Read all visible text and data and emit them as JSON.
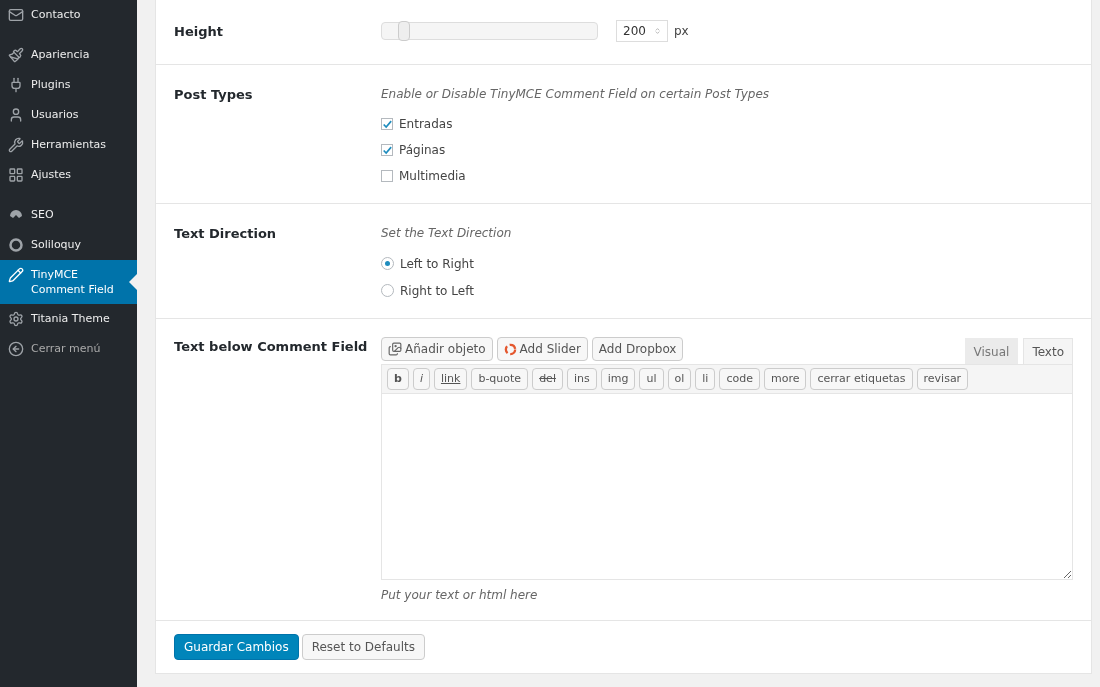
{
  "sidebar": {
    "items": [
      {
        "label": "Contacto",
        "selected": false
      },
      {
        "label": "Apariencia",
        "selected": false
      },
      {
        "label": "Plugins",
        "selected": false
      },
      {
        "label": "Usuarios",
        "selected": false
      },
      {
        "label": "Herramientas",
        "selected": false
      },
      {
        "label": "Ajustes",
        "selected": false
      },
      {
        "label": "SEO",
        "selected": false
      },
      {
        "label": "Soliloquy",
        "selected": false
      },
      {
        "label": "TinyMCE Comment Field",
        "selected": true
      },
      {
        "label": "Titania Theme",
        "selected": false
      },
      {
        "label": "Cerrar menú",
        "selected": false
      }
    ]
  },
  "settings": {
    "height": {
      "label": "Height",
      "level": 0.1,
      "value": "200",
      "unit": "px"
    },
    "post_types": {
      "label": "Post Types",
      "description": "Enable or Disable TinyMCE Comment Field on certain Post Types",
      "options": [
        {
          "label": "Entradas",
          "checked": true
        },
        {
          "label": "Páginas",
          "checked": true
        },
        {
          "label": "Multimedia",
          "checked": false
        }
      ]
    },
    "text_direction": {
      "label": "Text Direction",
      "description": "Set the Text Direction",
      "options": [
        {
          "label": "Left to Right",
          "selected": true
        },
        {
          "label": "Right to Left",
          "selected": false
        }
      ]
    },
    "text_below": {
      "label": "Text below Comment Field",
      "media_buttons": [
        "Añadir objeto",
        "Add Slider",
        "Add Dropbox"
      ],
      "tabs": [
        {
          "label": "Visual",
          "selected": false
        },
        {
          "label": "Texto",
          "selected": true
        }
      ],
      "quicktags": [
        "b",
        "i",
        "link",
        "b-quote",
        "del",
        "ins",
        "img",
        "ul",
        "ol",
        "li",
        "code",
        "more",
        "cerrar etiquetas",
        "revisar"
      ],
      "hint": "Put your text or html here"
    }
  },
  "buttons": {
    "save": "Guardar Cambios",
    "reset": "Reset to Defaults"
  }
}
